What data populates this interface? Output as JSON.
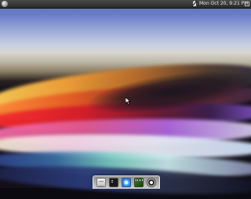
{
  "top_panel": {
    "clock_text": "Mon Oct 20,  9:21 PM"
  },
  "icons": {
    "menu": "menu-orb-icon",
    "battery": "battery-icon",
    "panel_resize": "panel-resize-icon",
    "cursor": "mouse-cursor-icon"
  },
  "dock": {
    "items": [
      {
        "name": "files",
        "icon": "file-manager-icon"
      },
      {
        "name": "terminal",
        "icon": "terminal-icon"
      },
      {
        "name": "browser",
        "icon": "browser-icon"
      },
      {
        "name": "media",
        "icon": "media-player-icon"
      },
      {
        "name": "settings",
        "icon": "settings-icon"
      }
    ]
  },
  "colors": {
    "panel_bg": "#2a2a2a",
    "panel_text": "#e6e6e6",
    "dock_bg": "#cfcfcf"
  }
}
